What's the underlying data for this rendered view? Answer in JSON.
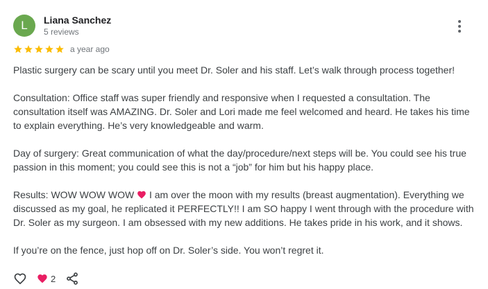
{
  "reviewer": {
    "initial": "L",
    "name": "Liana Sanchez",
    "review_count": "5 reviews",
    "avatar_color": "#6aa84f"
  },
  "rating": {
    "stars": 5,
    "max": 5,
    "star_color": "#fbbc04"
  },
  "posted": "a year ago",
  "review": {
    "p1": "Plastic surgery can be scary until you meet Dr. Soler and his staff. Let’s walk through process together!",
    "p2": "Consultation: Office staff was super friendly and responsive when I requested a consultation. The consultation itself was AMAZING. Dr. Soler and Lori made me feel welcomed and heard. He takes his time to explain everything. He’s very knowledgeable and warm.",
    "p3": "Day of surgery: Great communication of what the day/procedure/next steps will be. You could see his true passion in this moment; you could see this is not a “job” for him but his happy place.",
    "p4_before": "Results: WOW WOW WOW",
    "p4_emoji_icon": "heart-emoji-icon",
    "p4_after": "I am over the moon with my results (breast augmentation). Everything we discussed as my goal, he replicated it PERFECTLY!! I am SO happy I went through with the procedure with Dr. Soler as my surgeon. I am obsessed with my new additions. He takes pride in his work, and it shows.",
    "p5": "If you’re on the fence, just hop off on Dr. Soler’s side. You won’t regret it."
  },
  "actions": {
    "like_icon": "heart-outline-icon",
    "reaction_icon": "heart-emoji-icon",
    "reaction_count": "2",
    "share_icon": "share-icon"
  },
  "menu_icon": "more-vert-icon"
}
